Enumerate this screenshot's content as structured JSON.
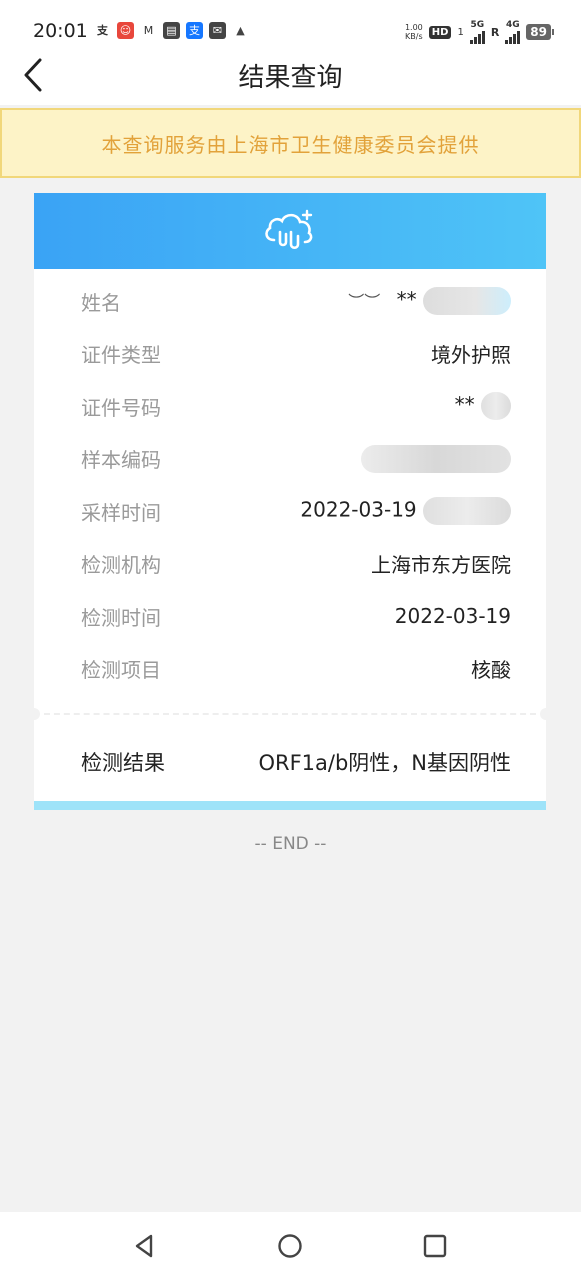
{
  "status_bar": {
    "time": "20:01",
    "net_speed_value": "1.00",
    "net_speed_unit": "KB/s",
    "hd_label": "HD",
    "sim1_tag": "1",
    "net1": "5G",
    "roaming": "R",
    "net2": "4G",
    "battery": "89",
    "notification_icons": [
      "alipay-icon",
      "red-character-icon",
      "gmail-icon",
      "book-icon",
      "alipay-blue-icon",
      "mail-box-icon",
      "cat-icon"
    ]
  },
  "header": {
    "title": "结果查询"
  },
  "notice": {
    "text": "本查询服务由上海市卫生健康委员会提供"
  },
  "card": {
    "rows": [
      {
        "label": "姓名",
        "value": "**"
      },
      {
        "label": "证件类型",
        "value": "境外护照"
      },
      {
        "label": "证件号码",
        "value": "**"
      },
      {
        "label": "样本编码",
        "value": ""
      },
      {
        "label": "采样时间",
        "value": "2022-03-19"
      },
      {
        "label": "检测机构",
        "value": "上海市东方医院"
      },
      {
        "label": "检测时间",
        "value": "2022-03-19"
      },
      {
        "label": "检测项目",
        "value": "核酸"
      }
    ],
    "result": {
      "label": "检测结果",
      "value": "ORF1a/b阴性，N基因阴性"
    }
  },
  "end_text": "-- END --",
  "colors": {
    "header_gradient_start": "#3aa3f5",
    "header_gradient_end": "#4fc4f7",
    "notice_bg": "#fdf3c7",
    "notice_text": "#e2a23a",
    "card_bottom_bar": "#9ee3f9"
  }
}
